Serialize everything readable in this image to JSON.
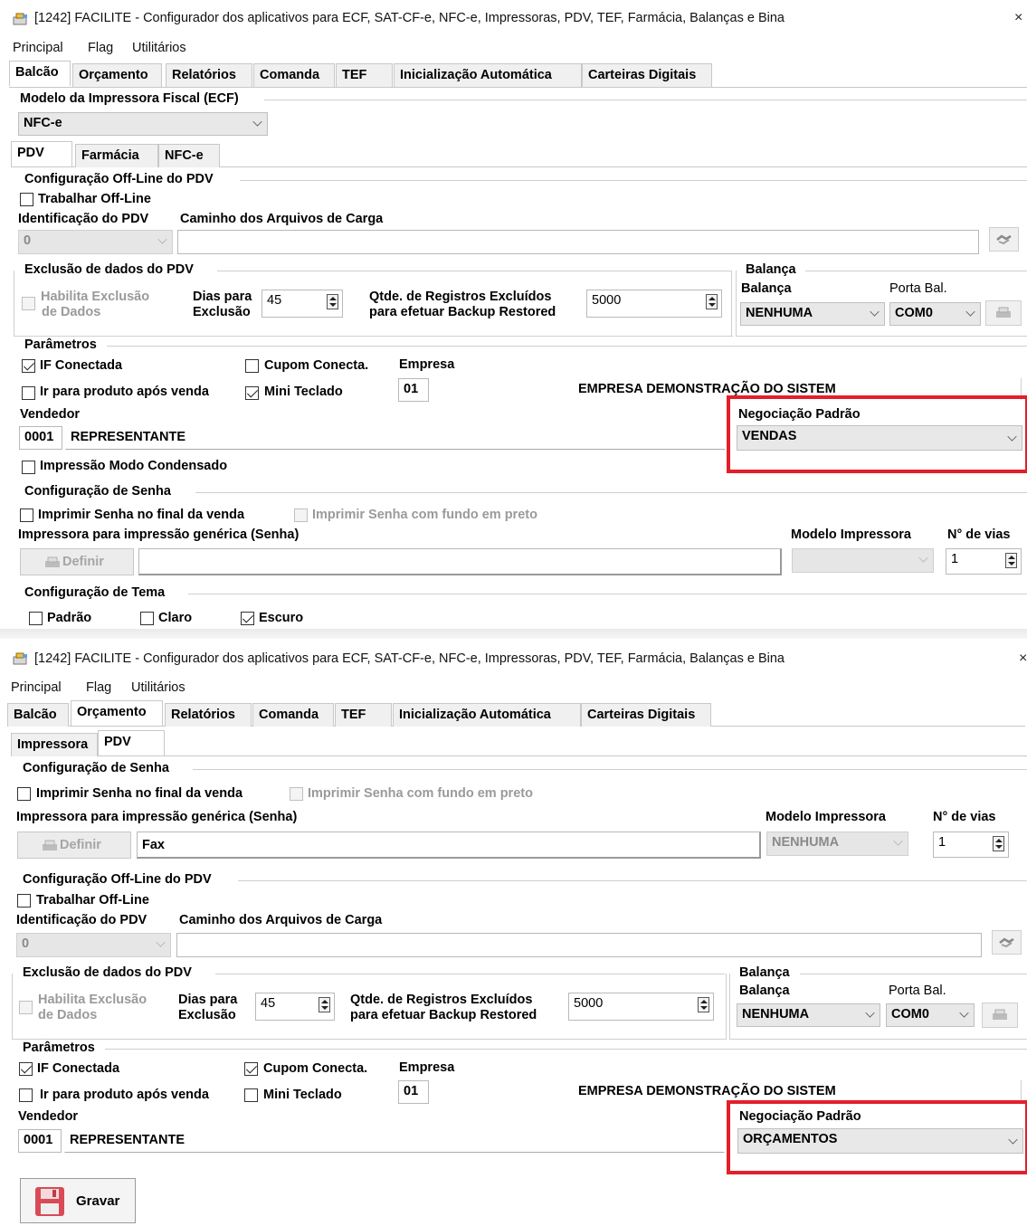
{
  "colors": {
    "highlight": "#e2202a",
    "border": "#c8c8c8",
    "disabled_text": "#9a9a9a"
  },
  "windows": [
    {
      "title": "[1242] FACILITE - Configurador dos aplicativos para ECF, SAT-CF-e, NFC-e, Impressoras, PDV, TEF, Farmácia, Balanças e Bina",
      "close": "×",
      "menu": [
        "Principal",
        "Flag",
        "Utilitários"
      ],
      "tabs": [
        "Balcão",
        "Orçamento",
        "Relatórios",
        "Comanda",
        "TEF",
        "Inicialização Automática",
        "Carteiras Digitais"
      ],
      "active_tab": "Balcão",
      "modelo_label": "Modelo da Impressora Fiscal (ECF)",
      "modelo_value": "NFC-e",
      "subtabs": [
        "PDV",
        "Farmácia",
        "NFC-e"
      ],
      "active_subtab": "PDV",
      "offline": {
        "group": "Configuração Off-Line do PDV",
        "trabalhar": "Trabalhar Off-Line",
        "ident_label": "Identificação do PDV",
        "caminho_label": "Caminho dos Arquivos de Carga",
        "ident_value": "0"
      },
      "exclusao": {
        "group": "Exclusão de dados do PDV",
        "habilita_1": "Habilita Exclusão",
        "habilita_2": "de Dados",
        "dias_1": "Dias para",
        "dias_2": "Exclusão",
        "dias_value": "45",
        "qtde_1": "Qtde. de Registros Excluídos",
        "qtde_2": "para efetuar Backup Restored",
        "qtde_value": "5000"
      },
      "balanca": {
        "group": "Balança",
        "balanca_label": "Balança",
        "porta_label": "Porta Bal.",
        "balanca_value": "NENHUMA",
        "porta_value": "COM0"
      },
      "parametros": {
        "group": "Parâmetros",
        "if_conectada": "IF Conectada",
        "cupom_conecta": "Cupom Conecta.",
        "empresa_label": "Empresa",
        "ir_produto": "Ir para produto após venda",
        "mini_teclado": "Mini Teclado",
        "empresa_code": "01",
        "empresa_name": "EMPRESA DEMONSTRAÇÃO DO SISTEM",
        "vendedor_label": "Vendedor",
        "vendedor_code": "0001",
        "vendedor_name": "REPRESENTANTE",
        "negociacao_label": "Negociação Padrão",
        "negociacao_value": "VENDAS",
        "impressao_condensado": "Impressão Modo Condensado",
        "checks": {
          "if_conectada": true,
          "cupom_conecta": false,
          "ir_produto": false,
          "mini_teclado": true
        }
      },
      "senha": {
        "group": "Configuração de Senha",
        "imprimir_final": "Imprimir Senha no final da venda",
        "imprimir_fundo": "Imprimir Senha com fundo em preto",
        "impressora_label": "Impressora para impressão genérica (Senha)",
        "modelo_label": "Modelo Impressora",
        "vias_label": "N° de vias",
        "definir": "Definir",
        "vias_value": "1"
      },
      "tema": {
        "group": "Configuração de Tema",
        "padrao": "Padrão",
        "claro": "Claro",
        "escuro": "Escuro"
      }
    },
    {
      "title": "[1242] FACILITE - Configurador dos aplicativos para ECF, SAT-CF-e, NFC-e, Impressoras, PDV, TEF, Farmácia, Balanças e Bina",
      "close": "×",
      "menu": [
        "Principal",
        "Flag",
        "Utilitários"
      ],
      "tabs": [
        "Balcão",
        "Orçamento",
        "Relatórios",
        "Comanda",
        "TEF",
        "Inicialização Automática",
        "Carteiras Digitais"
      ],
      "active_tab": "Orçamento",
      "subtabs": [
        "Impressora",
        "PDV"
      ],
      "active_subtab": "PDV",
      "senha": {
        "group": "Configuração de Senha",
        "imprimir_final": "Imprimir Senha no final da venda",
        "imprimir_fundo": "Imprimir Senha com fundo em preto",
        "impressora_label": "Impressora para impressão genérica (Senha)",
        "modelo_label": "Modelo Impressora",
        "vias_label": "N° de vias",
        "definir": "Definir",
        "impressora_value": "Fax",
        "modelo_value": "NENHUMA",
        "vias_value": "1"
      },
      "offline": {
        "group": "Configuração Off-Line do PDV",
        "trabalhar": "Trabalhar Off-Line",
        "ident_label": "Identificação do PDV",
        "caminho_label": "Caminho dos Arquivos de Carga",
        "ident_value": "0"
      },
      "exclusao": {
        "group": "Exclusão de dados do PDV",
        "habilita_1": "Habilita Exclusão",
        "habilita_2": "de Dados",
        "dias_1": "Dias para",
        "dias_2": "Exclusão",
        "dias_value": "45",
        "qtde_1": "Qtde. de Registros Excluídos",
        "qtde_2": "para efetuar Backup Restored",
        "qtde_value": "5000"
      },
      "balanca": {
        "group": "Balança",
        "balanca_label": "Balança",
        "porta_label": "Porta Bal.",
        "balanca_value": "NENHUMA",
        "porta_value": "COM0"
      },
      "parametros": {
        "group": "Parâmetros",
        "if_conectada": "IF Conectada",
        "cupom_conecta": "Cupom Conecta.",
        "empresa_label": "Empresa",
        "ir_produto": "Ir para produto após venda",
        "mini_teclado": "Mini Teclado",
        "empresa_code": "01",
        "empresa_name": "EMPRESA DEMONSTRAÇÃO DO SISTEM",
        "vendedor_label": "Vendedor",
        "vendedor_code": "0001",
        "vendedor_name": "REPRESENTANTE",
        "negociacao_label": "Negociação Padrão",
        "negociacao_value": "ORÇAMENTOS",
        "checks": {
          "if_conectada": true,
          "cupom_conecta": true,
          "ir_produto": false,
          "mini_teclado": false
        }
      },
      "gravar": "Gravar"
    }
  ]
}
